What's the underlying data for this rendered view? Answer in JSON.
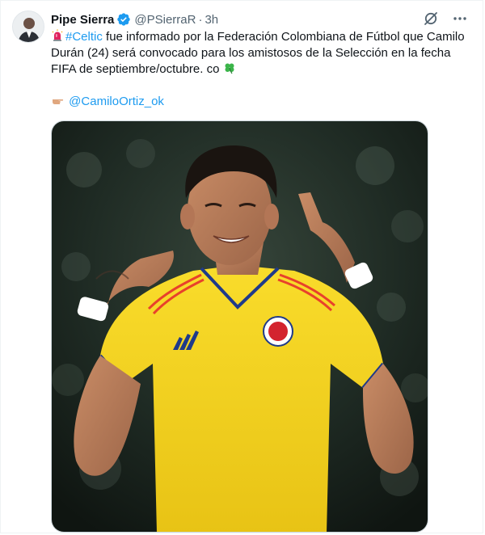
{
  "tweet": {
    "author": {
      "display_name": "Pipe Sierra",
      "handle": "@PSierraR",
      "separator": "·",
      "time": "3h",
      "verified": true
    },
    "body": {
      "hashtag": "#Celtic",
      "text": " fue informado por la Federación Colombiana de Fútbol que Camilo Durán (24) será convocado para los amistosos de la Selección en la fecha FIFA de septiembre/octubre. co "
    },
    "mention": "@CamiloOrtiz_ok",
    "media": {
      "alt": "Jugador con la camiseta amarilla de la Selección Colombia celebrando"
    },
    "icons": {
      "lead_emoji": "siren-icon",
      "clover_emoji": "four-leaf-clover-icon",
      "point_emoji": "pointing-hand-icon",
      "grok": "grok-icon",
      "more": "more-options-icon"
    },
    "colors": {
      "link": "#1d9bf0",
      "text": "#0f1419",
      "secondary": "#536471",
      "jersey": "#f6d21e"
    }
  }
}
